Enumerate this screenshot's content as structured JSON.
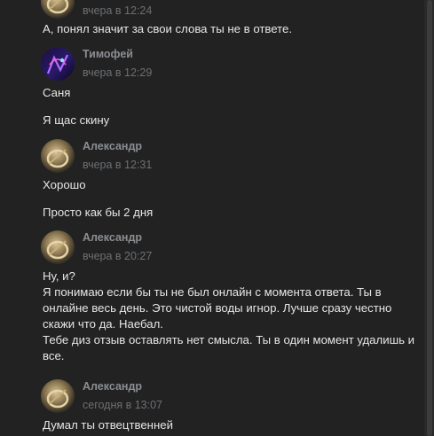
{
  "messages": [
    {
      "author": "",
      "time": "вчера в 12:24",
      "avatar": "alexandr",
      "lines": [
        "А, понял значит за свои слова ты не в ответе."
      ]
    },
    {
      "author": "Тимофей",
      "time": "вчера в 12:29",
      "avatar": "timofey",
      "lines": [
        "Саня",
        "Я щас скину"
      ]
    },
    {
      "author": "Александр",
      "time": "вчера в 12:31",
      "avatar": "alexandr",
      "lines": [
        "Хорошо",
        "Просто как бы 2 дня"
      ]
    },
    {
      "author": "Александр",
      "time": "вчера в 20:27",
      "avatar": "alexandr",
      "lines": [
        "Ну, и?\nЯ понимаю если бы ты не был онлайн с момента ответа. Ты в онлайне весь день. Это чистой воды игнор. Лучше сразу честно скажи что да. Наебал.\nТебе диз отзыв оставлять нет смысла. Ты в один момент удалишь и все."
      ]
    },
    {
      "author": "Александр",
      "time": "сегодня в 13:07",
      "avatar": "alexandr",
      "lines": [
        "Думал ты отвецтвенней"
      ]
    }
  ],
  "colors": {
    "background": "#222222",
    "author": "#8b8e92",
    "time": "#6c6f73",
    "text": "#e6e6e6"
  },
  "icons": {
    "alexandr": "avatar-photo-gold-ring",
    "timofey": "avatar-photo-neon-purple"
  }
}
